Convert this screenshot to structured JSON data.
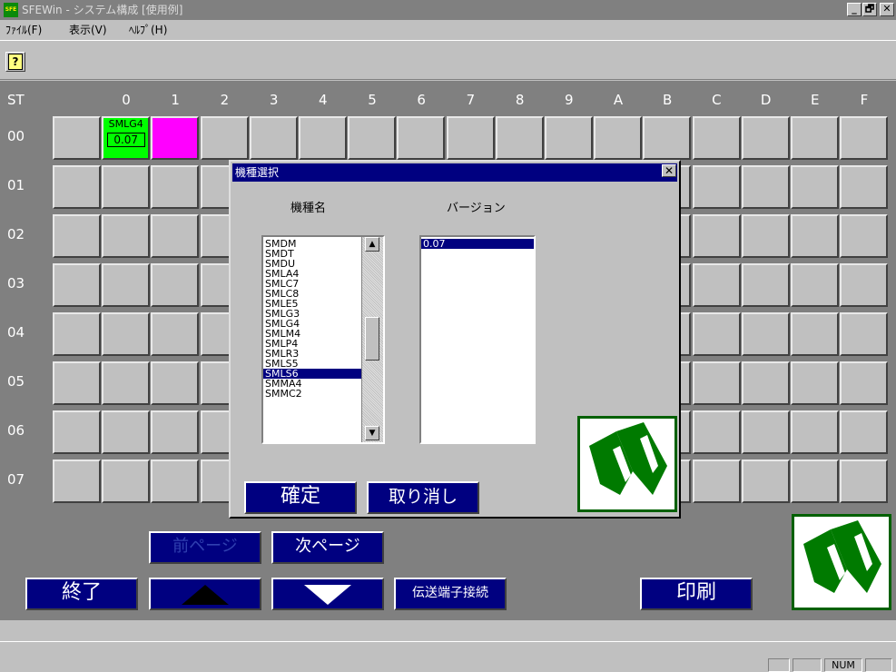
{
  "window": {
    "icon_text": "SFE",
    "title": "SFEWin - システム構成 [使用例]",
    "minimize": "_",
    "maximize": "🗗",
    "close": "✕"
  },
  "menu": [
    "ﾌｧｲﾙ(F)",
    "表示(V)",
    "ﾍﾙﾌﾟ(H)"
  ],
  "toolbar": {
    "help": "?"
  },
  "grid": {
    "corner_label": "ST",
    "columns": [
      "0",
      "1",
      "2",
      "3",
      "4",
      "5",
      "6",
      "7",
      "8",
      "9",
      "A",
      "B",
      "C",
      "D",
      "E",
      "F"
    ],
    "rows": [
      "00",
      "01",
      "02",
      "03",
      "04",
      "05",
      "06",
      "07"
    ],
    "filled_cell": {
      "model": "SMLG4",
      "version": "0.07",
      "color": "#00ff00"
    },
    "marked_cell_color": "#ff00ff"
  },
  "dialog": {
    "title": "機種選択",
    "close": "✕",
    "model_label": "機種名",
    "version_label": "バージョン",
    "models": [
      "SMDM",
      "SMDT",
      "SMDU",
      "SMLA4",
      "SMLC7",
      "SMLC8",
      "SMLE5",
      "SMLG3",
      "SMLG4",
      "SMLM4",
      "SMLP4",
      "SMLR3",
      "SMLS5",
      "SMLS6",
      "SMMA4",
      "SMMC2"
    ],
    "selected_model": "SMLS6",
    "versions": [
      "0.07"
    ],
    "selected_version": "0.07",
    "ok_button": "確定",
    "cancel_button": "取り消し",
    "logo_icon": "company-logo"
  },
  "buttons": {
    "prev_page": "前ページ",
    "next_page": "次ページ",
    "exit": "終了",
    "up_icon": "up-arrow",
    "down_icon": "down-arrow",
    "transmission": "伝送端子接続",
    "print": "印刷"
  },
  "statusbar": {
    "num": "NUM"
  },
  "colors": {
    "nav_button": "#000080",
    "workspace": "#808080",
    "logo_green": "#007a00"
  }
}
